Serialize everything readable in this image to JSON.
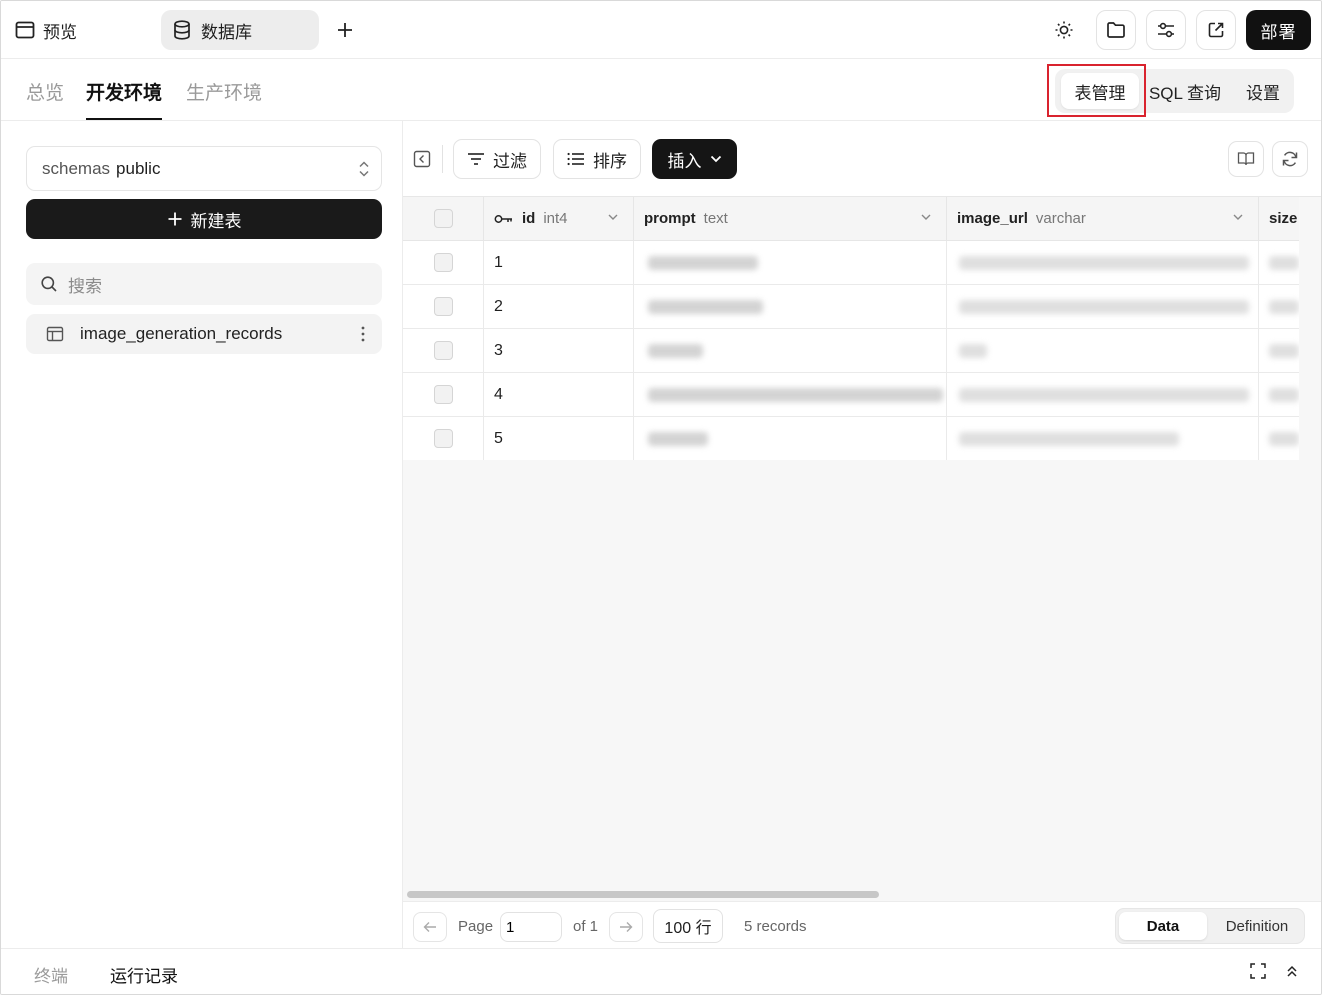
{
  "topbar": {
    "preview_label": "预览",
    "database_label": "数据库",
    "deploy_label": "部署"
  },
  "nav": {
    "tabs": [
      "总览",
      "开发环境",
      "生产环境"
    ],
    "active_tab": "开发环境",
    "segments": [
      "表管理",
      "SQL 查询",
      "设置"
    ],
    "active_segment": "表管理"
  },
  "sidebar": {
    "schema_prefix": "schemas",
    "schema_value": "public",
    "new_table_label": "新建表",
    "search_placeholder": "搜索",
    "tables": [
      "image_generation_records"
    ]
  },
  "toolbar": {
    "filter_label": "过滤",
    "sort_label": "排序",
    "insert_label": "插入"
  },
  "grid": {
    "columns": [
      {
        "name": "id",
        "type": "int4"
      },
      {
        "name": "prompt",
        "type": "text"
      },
      {
        "name": "image_url",
        "type": "varchar"
      },
      {
        "name": "size",
        "type": ""
      }
    ],
    "row_ids": [
      "1",
      "2",
      "3",
      "4",
      "5"
    ]
  },
  "pager": {
    "page_label": "Page",
    "page_value": "1",
    "of_label": "of 1",
    "rows_label": "100 行",
    "records_label": "5 records",
    "view_data": "Data",
    "view_definition": "Definition"
  },
  "bottombar": {
    "terminal_label": "终端",
    "run_log_label": "运行记录"
  },
  "colors": {
    "accent_dark": "#111111",
    "highlight_red": "#d9232e"
  }
}
